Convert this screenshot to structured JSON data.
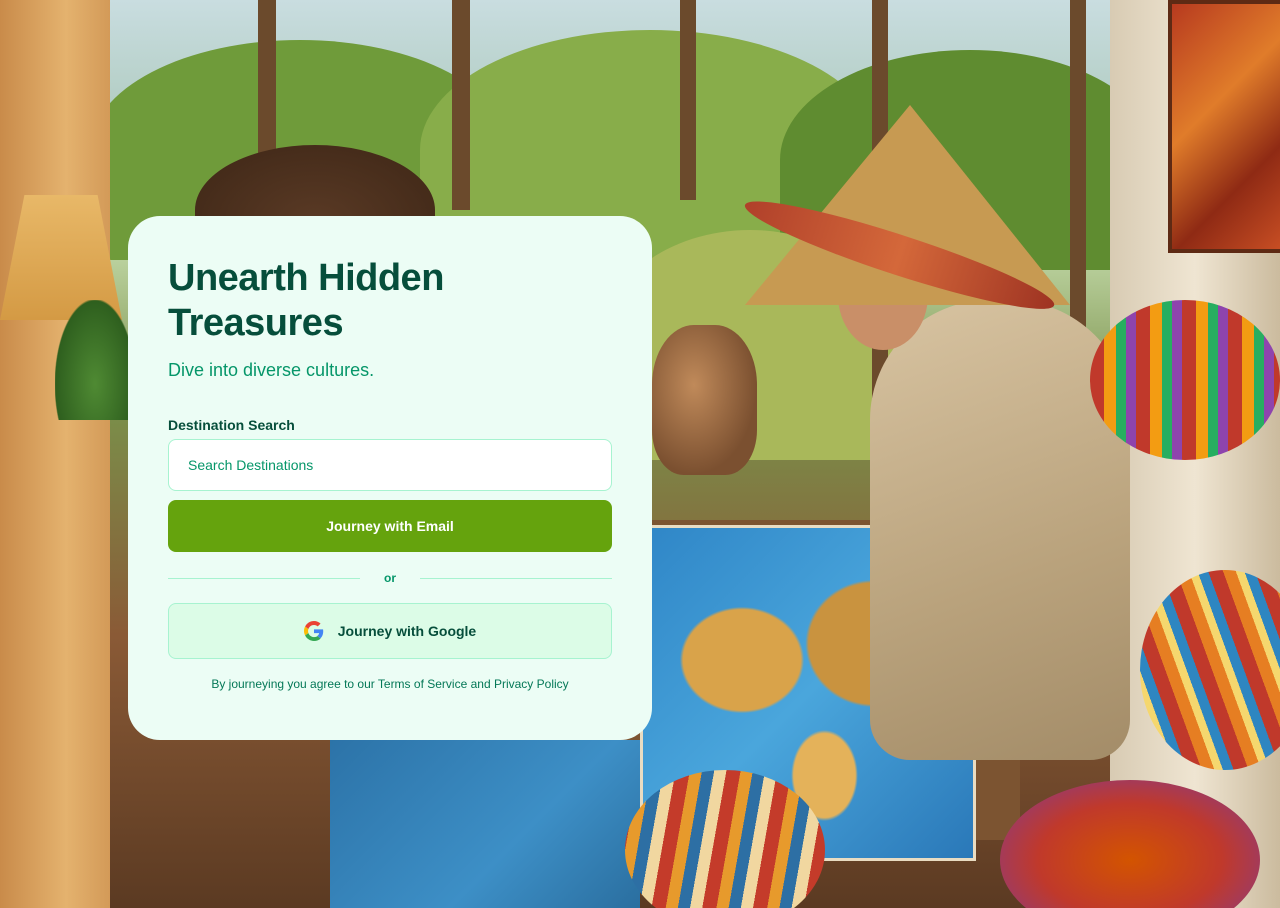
{
  "hero": {
    "title_line1": "Unearth Hidden",
    "title_line2": "Treasures",
    "subtitle": "Dive into diverse cultures."
  },
  "search": {
    "label": "Destination Search",
    "placeholder": "Search Destinations",
    "value": ""
  },
  "actions": {
    "email_button": "Journey with Email",
    "divider_text": "or",
    "google_button": "Journey with Google",
    "google_icon": "google-g-icon"
  },
  "legal": {
    "prefix": "By journeying you agree to our",
    "terms_link": "Terms of Service",
    "conjunction": "and",
    "privacy_link": "Privacy Policy"
  },
  "colors": {
    "card_bg": "#ecfdf5",
    "title": "#064e3b",
    "accent": "#059669",
    "primary_button": "#65a30d",
    "google_button_bg": "#dcfce7",
    "border": "#a7f3d0"
  }
}
